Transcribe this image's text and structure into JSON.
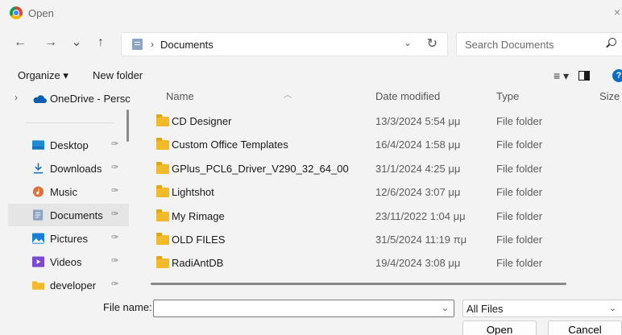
{
  "window": {
    "title": "Open",
    "close_glyph": "×"
  },
  "nav": {
    "back": "←",
    "forward": "→",
    "recent": "⌄",
    "up": "↑",
    "address": {
      "separator": "›",
      "path": "Documents",
      "dropdown": "⌄",
      "refresh": "↻"
    },
    "search": {
      "placeholder": "Search Documents"
    }
  },
  "commands": {
    "organize": "Organize ▾",
    "new_folder": "New folder",
    "view_menu": "≡ ▾"
  },
  "sidebar": {
    "items": [
      {
        "label": "OneDrive - Persc",
        "icon": "cloud-icon",
        "pinned": false
      },
      {
        "label": "Desktop",
        "icon": "desktop-icon",
        "pinned": true
      },
      {
        "label": "Downloads",
        "icon": "download-icon",
        "pinned": true
      },
      {
        "label": "Music",
        "icon": "music-icon",
        "pinned": true
      },
      {
        "label": "Documents",
        "icon": "documents-icon",
        "pinned": true,
        "selected": true
      },
      {
        "label": "Pictures",
        "icon": "pictures-icon",
        "pinned": true
      },
      {
        "label": "Videos",
        "icon": "videos-icon",
        "pinned": true
      },
      {
        "label": "developer",
        "icon": "folder-icon",
        "pinned": true
      }
    ],
    "pin_glyph": "📌"
  },
  "columns": {
    "name": "Name",
    "date": "Date modified",
    "type": "Type",
    "size": "Size"
  },
  "files": [
    {
      "name": "CD Designer",
      "date": "13/3/2024 5:54 μμ",
      "type": "File folder"
    },
    {
      "name": "Custom Office Templates",
      "date": "16/4/2024 1:58 μμ",
      "type": "File folder"
    },
    {
      "name": "GPlus_PCL6_Driver_V290_32_64_00",
      "date": "31/1/2024 4:25 μμ",
      "type": "File folder"
    },
    {
      "name": "Lightshot",
      "date": "12/6/2024 3:07 μμ",
      "type": "File folder"
    },
    {
      "name": "My Rimage",
      "date": "23/11/2022 1:04 μμ",
      "type": "File folder"
    },
    {
      "name": "OLD FILES",
      "date": "31/5/2024 11:19 πμ",
      "type": "File folder"
    },
    {
      "name": "RadiAntDB",
      "date": "19/4/2024 3:08 μμ",
      "type": "File folder"
    }
  ],
  "footer": {
    "filename_label": "File name:",
    "filename_value": "",
    "filter": "All Files",
    "open": "Open",
    "cancel": "Cancel"
  },
  "colors": {
    "accent": "#0a6dc2",
    "folder": "#f2b92a",
    "selected_bg": "#e5e5e5"
  }
}
